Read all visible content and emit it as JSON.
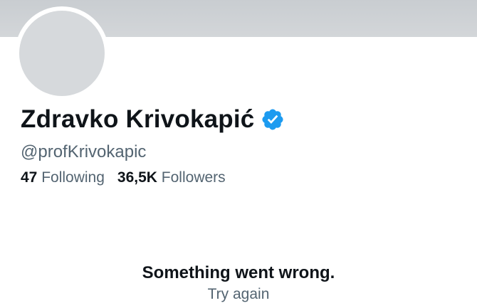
{
  "profile": {
    "display_name": "Zdravko Krivokapić",
    "handle": "@profKrivokapic",
    "verified_icon": "verified-badge-icon",
    "verified_color": "#1d9bf0"
  },
  "stats": {
    "following_count": "47",
    "following_label": "Following",
    "followers_count": "36,5K",
    "followers_label": "Followers"
  },
  "error": {
    "message": "Something went wrong.",
    "retry_label": "Try again"
  },
  "colors": {
    "text_primary": "#0f1419",
    "text_secondary": "#536471",
    "banner": "#cfd3d6",
    "avatar_placeholder": "#d6d9dc"
  }
}
